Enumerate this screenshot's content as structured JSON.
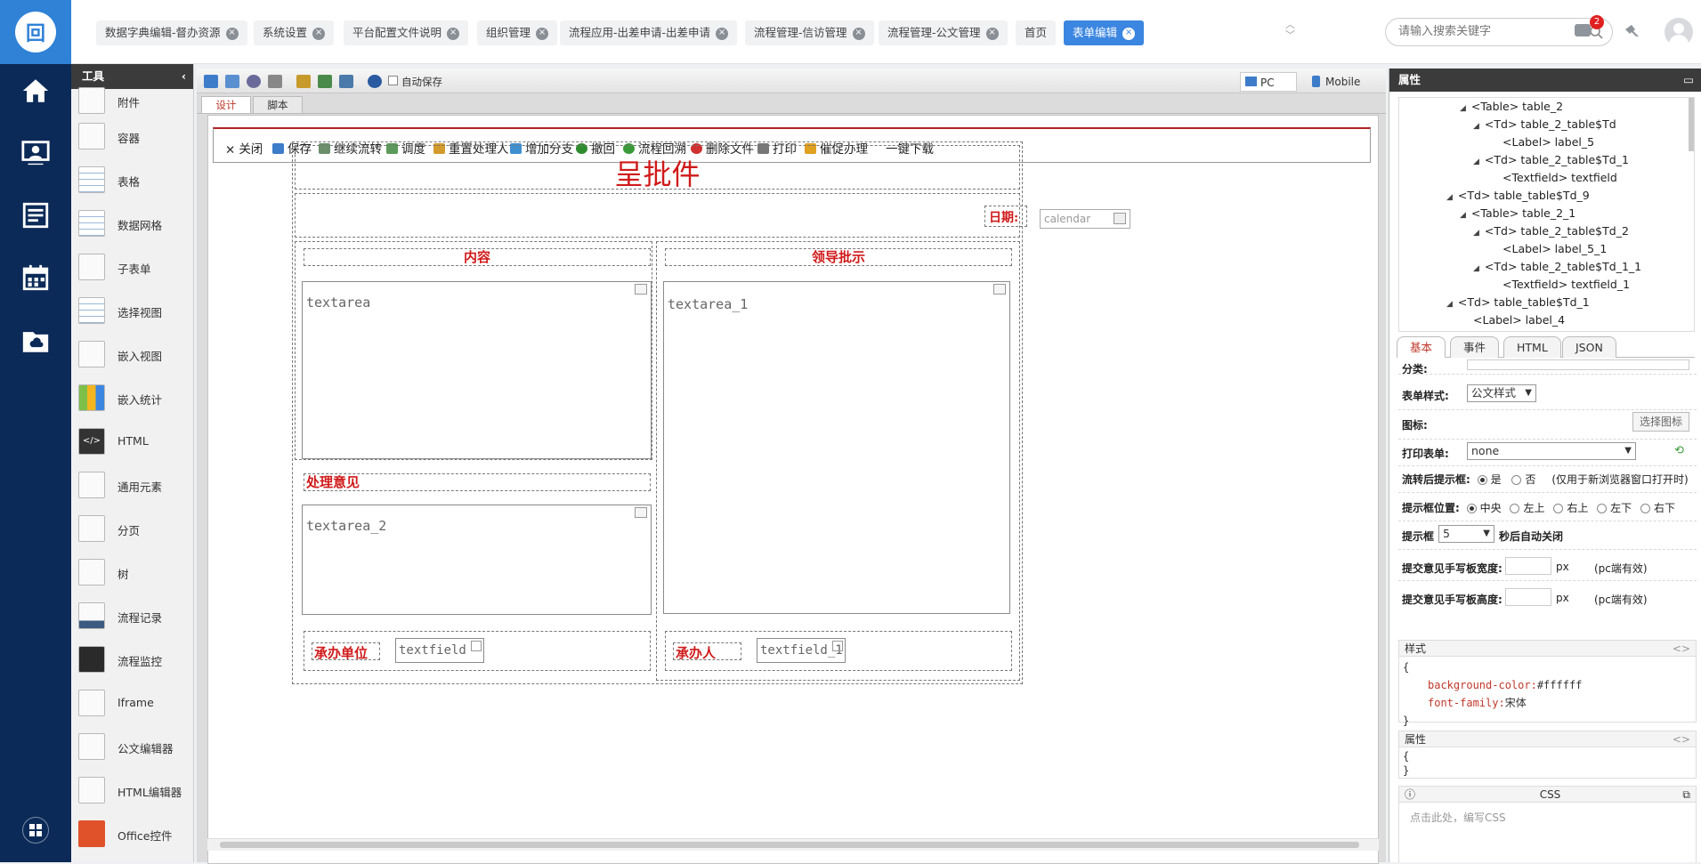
{
  "topbar": {
    "tabs": [
      {
        "label": "数据字典编辑-督办资源",
        "active": false
      },
      {
        "label": "系统设置",
        "active": false
      },
      {
        "label": "平台配置文件说明",
        "active": false
      },
      {
        "label": "组织管理",
        "active": false
      },
      {
        "label": "流程应用-出差申请-出差申请",
        "active": false
      },
      {
        "label": "流程管理-信访管理",
        "active": false
      },
      {
        "label": "流程管理-公文管理",
        "active": false
      },
      {
        "label": "首页",
        "active": false
      },
      {
        "label": "表单编辑",
        "active": true
      }
    ],
    "search_placeholder": "请输入搜索关键字",
    "notification_count": "2"
  },
  "toolbox": {
    "title": "工具",
    "items": [
      "附件",
      "容器",
      "表格",
      "数据网格",
      "子表单",
      "选择视图",
      "嵌入视图",
      "嵌入统计",
      "HTML",
      "通用元素",
      "分页",
      "树",
      "流程记录",
      "流程监控",
      "Iframe",
      "公文编辑器",
      "HTML编辑器",
      "Office控件"
    ]
  },
  "designer": {
    "autosave_label": "自动保存",
    "pc_label": "PC",
    "mobile_label": "Mobile",
    "tab_design": "设计",
    "tab_script": "脚本",
    "form_buttons": [
      "关闭",
      "保存",
      "继续流转",
      "调度",
      "重置处理人",
      "增加分支",
      "撤回",
      "流程回溯",
      "删除文件",
      "打印",
      "催促办理",
      "一键下载"
    ],
    "form": {
      "title": "呈批件",
      "date_label": "日期:",
      "date_placeholder": "calendar",
      "content_label": "内容",
      "leader_label": "领导批示",
      "textarea": "textarea",
      "textarea_1": "textarea_1",
      "opinion_label": "处理意见",
      "textarea_2": "textarea_2",
      "unit_label": "承办单位",
      "unit_field": "textfield",
      "person_label": "承办人",
      "person_field": "textfield_1"
    }
  },
  "props": {
    "title": "属性",
    "tree": [
      {
        "text": "<Table> table_2",
        "arrow": "◢"
      },
      {
        "text": "<Td> table_2_table$Td",
        "arrow": "◢"
      },
      {
        "text": "<Label> label_5",
        "arrow": ""
      },
      {
        "text": "<Td> table_2_table$Td_1",
        "arrow": "◢"
      },
      {
        "text": "<Textfield> textfield",
        "arrow": ""
      },
      {
        "text": "<Td> table_table$Td_9",
        "arrow": "◢"
      },
      {
        "text": "<Table> table_2_1",
        "arrow": "◢"
      },
      {
        "text": "<Td> table_2_table$Td_2",
        "arrow": "◢"
      },
      {
        "text": "<Label> label_5_1",
        "arrow": ""
      },
      {
        "text": "<Td> table_2_table$Td_1_1",
        "arrow": "◢"
      },
      {
        "text": "<Textfield> textfield_1",
        "arrow": ""
      },
      {
        "text": "<Td> table_table$Td_1",
        "arrow": "◢"
      },
      {
        "text": "<Label> label_4",
        "arrow": ""
      }
    ],
    "tabs": [
      "基本",
      "事件",
      "HTML",
      "JSON"
    ],
    "category_label": "分类:",
    "form_style_label": "表单样式:",
    "form_style_value": "公文样式",
    "icon_label": "图标:",
    "choose_icon": "选择图标",
    "print_form_label": "打印表单:",
    "print_form_value": "none",
    "prompt_after_label": "流转后提示框:",
    "yes": "是",
    "no": "否",
    "prompt_after_note": "(仅用于新浏览器窗口打开时)",
    "prompt_pos_label": "提示框位置:",
    "positions": [
      "中央",
      "左上",
      "右上",
      "左下",
      "右下"
    ],
    "prompt_box_label": "提示框",
    "prompt_seconds": "5",
    "auto_close": "秒后自动关闭",
    "width_label": "提交意见手写板宽度:",
    "height_label": "提交意见手写板高度:",
    "px": "px",
    "pc_valid": "(pc端有效)",
    "style_label": "样式",
    "style_open": "{",
    "style_prop1": "background-color:",
    "style_val1": "#ffffff",
    "style_prop2": "font-family:",
    "style_val2": "宋体",
    "style_close": "}",
    "attr_label": "属性",
    "attr_open": "{",
    "attr_close": "}",
    "css_label": "CSS",
    "css_hint": "点击此处，编写CSS"
  }
}
